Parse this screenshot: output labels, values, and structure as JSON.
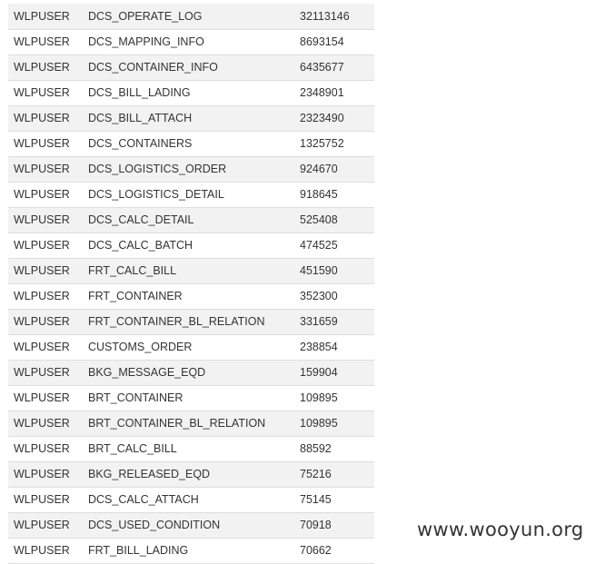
{
  "table": {
    "rows": [
      [
        "WLPUSER",
        "DCS_OPERATE_LOG",
        "32113146"
      ],
      [
        "WLPUSER",
        "DCS_MAPPING_INFO",
        "8693154"
      ],
      [
        "WLPUSER",
        "DCS_CONTAINER_INFO",
        "6435677"
      ],
      [
        "WLPUSER",
        "DCS_BILL_LADING",
        "2348901"
      ],
      [
        "WLPUSER",
        "DCS_BILL_ATTACH",
        "2323490"
      ],
      [
        "WLPUSER",
        "DCS_CONTAINERS",
        "1325752"
      ],
      [
        "WLPUSER",
        "DCS_LOGISTICS_ORDER",
        "924670"
      ],
      [
        "WLPUSER",
        "DCS_LOGISTICS_DETAIL",
        "918645"
      ],
      [
        "WLPUSER",
        "DCS_CALC_DETAIL",
        "525408"
      ],
      [
        "WLPUSER",
        "DCS_CALC_BATCH",
        "474525"
      ],
      [
        "WLPUSER",
        "FRT_CALC_BILL",
        "451590"
      ],
      [
        "WLPUSER",
        "FRT_CONTAINER",
        "352300"
      ],
      [
        "WLPUSER",
        "FRT_CONTAINER_BL_RELATION",
        "331659"
      ],
      [
        "WLPUSER",
        "CUSTOMS_ORDER",
        "238854"
      ],
      [
        "WLPUSER",
        "BKG_MESSAGE_EQD",
        "159904"
      ],
      [
        "WLPUSER",
        "BRT_CONTAINER",
        "109895"
      ],
      [
        "WLPUSER",
        "BRT_CONTAINER_BL_RELATION",
        "109895"
      ],
      [
        "WLPUSER",
        "BRT_CALC_BILL",
        "88592"
      ],
      [
        "WLPUSER",
        "BKG_RELEASED_EQD",
        "75216"
      ],
      [
        "WLPUSER",
        "DCS_CALC_ATTACH",
        "75145"
      ],
      [
        "WLPUSER",
        "DCS_USED_CONDITION",
        "70918"
      ],
      [
        "WLPUSER",
        "FRT_BILL_LADING",
        "70662"
      ]
    ]
  },
  "watermark": {
    "text": "www.wooyun.org"
  }
}
